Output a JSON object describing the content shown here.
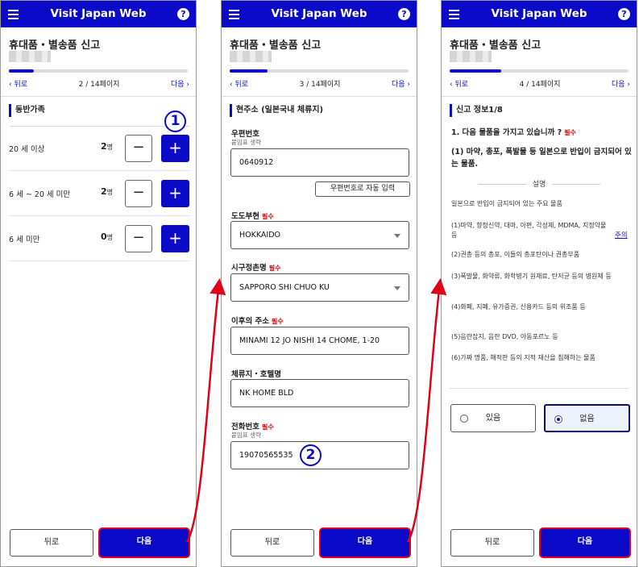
{
  "header": {
    "title": "Visit Japan Web",
    "help": "?"
  },
  "colors": {
    "brand": "#0a0ac8",
    "required": "#d40000",
    "highlight": "#e0001a"
  },
  "page_title": "휴대품・별송품 신고",
  "nav": {
    "back": "뒤로",
    "next": "다음"
  },
  "screen1": {
    "page_indicator": "2 / 14페이지",
    "progress": 0.14,
    "section": "동반가족",
    "rows": [
      {
        "label": "20 세 이상",
        "count": "2",
        "unit": "명"
      },
      {
        "label": "6 세 ~ 20 세 미만",
        "count": "2",
        "unit": "명"
      },
      {
        "label": "6 세 미만",
        "count": "0",
        "unit": "명"
      }
    ],
    "minus": "−",
    "plus": "+",
    "callout": "1"
  },
  "screen2": {
    "page_indicator": "3 / 14페이지",
    "progress": 0.21,
    "section": "현주소 (일본국내 체류지)",
    "required_tag": "필수",
    "postal_label": "우편번호",
    "postal_hint": "붙임표 생략",
    "postal_value": "0640912",
    "auto_fill": "우편번호로 자동 입력",
    "prefecture_label": "도도부현",
    "prefecture_value": "HOKKAIDO",
    "city_label": "시구정촌명",
    "city_value": "SAPPORO SHI CHUO KU",
    "address_label": "이후의 주소",
    "address_value": "MINAMI 12 JO NISHI 14 CHOME, 1-20",
    "hotel_label": "체류지・호텔명",
    "hotel_value": "NK HOME BLD",
    "phone_label": "전화번호",
    "phone_hint": "붙임표 생략",
    "phone_value": "19070565535",
    "callout": "2"
  },
  "screen3": {
    "page_indicator": "4 / 14페이지",
    "progress": 0.29,
    "section": "신고 정보1/8",
    "question": "1. 다음 물품을 가지고 있습니까 ?",
    "required_tag": "필수",
    "sub_question": "(1) 마약, 총포, 폭발물 등 일본으로 반입이 금지되어 있는 물품.",
    "explain_title": "설명",
    "explain_intro": "일본으로 반입이 금지되어 있는 주요 물품",
    "items": [
      "(1)마약, 향정신약, 대마, 아편, 각성제, MDMA, 지정약물 등",
      "(2)권총 등의 총포, 이들의 총포탄이나 권총부품",
      "(3)폭발물, 화약류, 화학병기 원재료, 탄저균 등의 병원체 등",
      "(4)화폐, 지폐, 유가증권, 신용카드 등의 위조품 등",
      "(5)음란잡지, 음란 DVD, 아동포르노 등",
      "(6)가짜 명품, 해적판 등의 지적 재산을 침해하는 물품"
    ],
    "note_link": "주의",
    "option_yes": "있음",
    "option_no": "없음",
    "selected": "없음"
  }
}
